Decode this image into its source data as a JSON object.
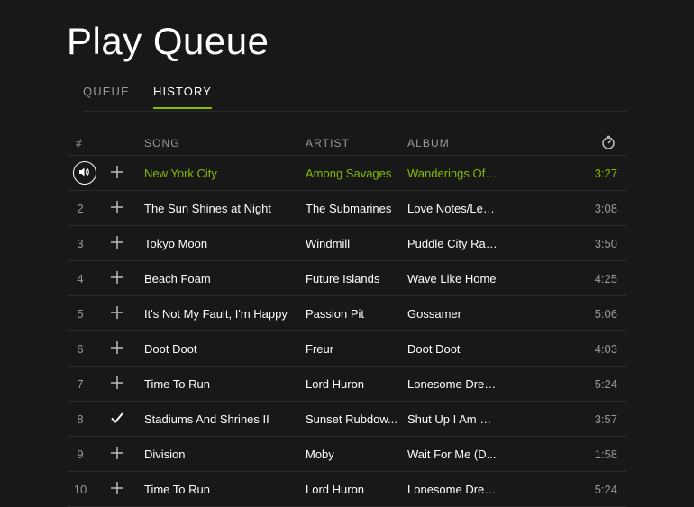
{
  "page": {
    "title": "Play Queue"
  },
  "tabs": [
    {
      "label": "QUEUE",
      "active": false
    },
    {
      "label": "HISTORY",
      "active": true
    }
  ],
  "columns": {
    "num": "#",
    "song": "SONG",
    "artist": "ARTIST",
    "album": "ALBUM",
    "duration_icon": "stopwatch-icon"
  },
  "colors": {
    "accent": "#84bd00",
    "background": "#181818",
    "muted": "#9a9a9a"
  },
  "tracks": [
    {
      "num": "",
      "song": "New York City",
      "artist": "Among Savages",
      "album": "Wanderings Of ...",
      "duration": "3:27",
      "playing": true,
      "saved": false
    },
    {
      "num": "2",
      "song": "The Sun Shines at Night",
      "artist": "The Submarines",
      "album": "Love Notes/Lett...",
      "duration": "3:08",
      "saved": false
    },
    {
      "num": "3",
      "song": "Tokyo Moon",
      "artist": "Windmill",
      "album": "Puddle City Rac...",
      "duration": "3:50",
      "saved": false
    },
    {
      "num": "4",
      "song": "Beach Foam",
      "artist": "Future Islands",
      "album": "Wave Like Home",
      "duration": "4:25",
      "saved": false
    },
    {
      "num": "5",
      "song": "It's Not My Fault, I'm Happy",
      "artist": "Passion Pit",
      "album": "Gossamer",
      "duration": "5:06",
      "saved": false
    },
    {
      "num": "6",
      "song": "Doot Doot",
      "artist": "Freur",
      "album": "Doot Doot",
      "duration": "4:03",
      "saved": false
    },
    {
      "num": "7",
      "song": "Time To Run",
      "artist": "Lord Huron",
      "album": "Lonesome Drea...",
      "duration": "5:24",
      "saved": false
    },
    {
      "num": "8",
      "song": "Stadiums And Shrines II",
      "artist": "Sunset Rubdow...",
      "album": "Shut Up I Am Dr...",
      "duration": "3:57",
      "saved": true
    },
    {
      "num": "9",
      "song": "Division",
      "artist": "Moby",
      "album": "Wait For Me (D...",
      "duration": "1:58",
      "saved": false
    },
    {
      "num": "10",
      "song": "Time To Run",
      "artist": "Lord Huron",
      "album": "Lonesome Drea...",
      "duration": "5:24",
      "saved": false
    }
  ]
}
